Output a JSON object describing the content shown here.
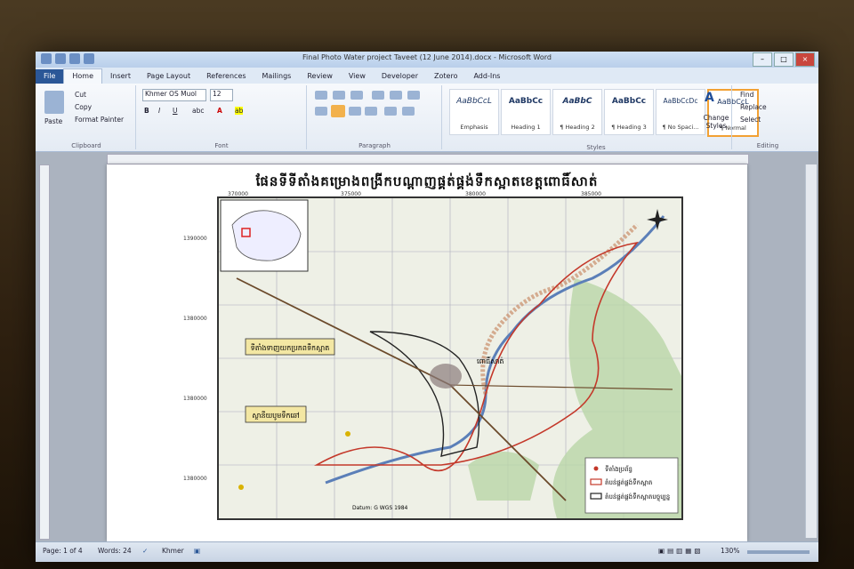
{
  "window": {
    "title": "Final Photo Water project Taveet (12 June 2014).docx - Microsoft Word"
  },
  "tabs": [
    "File",
    "Home",
    "Insert",
    "Page Layout",
    "References",
    "Mailings",
    "Review",
    "View",
    "Developer",
    "Zotero",
    "Add-Ins"
  ],
  "active_tab": "Home",
  "clipboard": {
    "paste": "Paste",
    "cut": "Cut",
    "copy": "Copy",
    "format_painter": "Format Painter",
    "label": "Clipboard"
  },
  "font": {
    "name": "Khmer OS Muol",
    "size": "12",
    "label": "Font"
  },
  "paragraph": {
    "label": "Paragraph"
  },
  "styles": {
    "label": "Styles",
    "items": [
      {
        "sample": "AaBbCcL",
        "name": "Emphasis"
      },
      {
        "sample": "AaBbCc",
        "name": "Heading 1"
      },
      {
        "sample": "AaBbC",
        "name": "¶ Heading 2"
      },
      {
        "sample": "AaBbCc",
        "name": "¶ Heading 3"
      },
      {
        "sample": "AaBbCcDc",
        "name": "¶ No Spaci..."
      },
      {
        "sample": "AaBbCcL",
        "name": "¶ Normal"
      }
    ],
    "change_styles": "Change Styles"
  },
  "editing": {
    "find": "Find",
    "replace": "Replace",
    "select": "Select",
    "label": "Editing"
  },
  "document": {
    "title": "ផែនទីទីតាំងគម្រោងពង្រីកបណ្ដាញផ្គត់ផ្គង់ទឹកស្អាតខេត្តពោធិ៍សាត់",
    "map_labels": {
      "label_a": "ទីតាំងទាញយកប្រភពទឹកស្អាត",
      "label_b": "ស្ថានីយបូមទឹកឆៅ",
      "city": "ពោធិ៍សាត់",
      "legend_a": "ទីតាំងប្រព័ន្ធ",
      "legend_b": "តំបន់ផ្គត់ផ្គង់ទឹកស្អាត",
      "legend_c": "តំបន់ផ្គត់ផ្គង់ទឹកស្អាតបច្ចុប្បន្ន",
      "datum": "Datum: G WGS 1984",
      "x_ticks": [
        "370000",
        "375000",
        "380000",
        "385000"
      ],
      "y_ticks": [
        "1390000",
        "1380000",
        "1380000",
        "1380000"
      ]
    }
  },
  "status": {
    "page": "Page: 1 of 4",
    "words": "Words: 24",
    "lang": "Khmer",
    "zoom": "130%"
  }
}
